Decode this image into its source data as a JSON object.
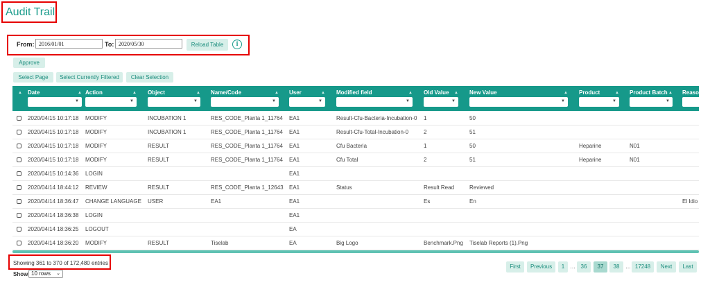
{
  "title": "Audit Trail",
  "filter": {
    "from_label": "From:",
    "from_value": "2016/01/01",
    "to_label": "To:",
    "to_value": "2020/05/30",
    "reload_label": "Reload Table",
    "info_icon": "info-circle-icon"
  },
  "actions": {
    "approve": "Approve",
    "select_page": "Select Page",
    "select_filtered": "Select Currently Filtered",
    "clear_selection": "Clear Selection"
  },
  "columns": [
    "Date",
    "Action",
    "Object",
    "Name/Code",
    "User",
    "Modified field",
    "Old Value",
    "New Value",
    "Product",
    "Product Batch",
    "Reaso"
  ],
  "rows": [
    [
      "2020/04/15 10:17:18",
      "MODIFY",
      "INCUBATION 1",
      "RES_CODE_Planta 1_11764",
      "EA1",
      "Result-Cfu-Bacteria-Incubation-0",
      "1",
      "50",
      "",
      "",
      ""
    ],
    [
      "2020/04/15 10:17:18",
      "MODIFY",
      "INCUBATION 1",
      "RES_CODE_Planta 1_11764",
      "EA1",
      "Result-Cfu-Total-Incubation-0",
      "2",
      "51",
      "",
      "",
      ""
    ],
    [
      "2020/04/15 10:17:18",
      "MODIFY",
      "RESULT",
      "RES_CODE_Planta 1_11764",
      "EA1",
      "Cfu Bacteria",
      "1",
      "50",
      "Heparine",
      "N01",
      ""
    ],
    [
      "2020/04/15 10:17:18",
      "MODIFY",
      "RESULT",
      "RES_CODE_Planta 1_11764",
      "EA1",
      "Cfu Total",
      "2",
      "51",
      "Heparine",
      "N01",
      ""
    ],
    [
      "2020/04/15 10:14:36",
      "LOGIN",
      "",
      "",
      "EA1",
      "",
      "",
      "",
      "",
      "",
      ""
    ],
    [
      "2020/04/14 18:44:12",
      "REVIEW",
      "RESULT",
      "RES_CODE_Planta 1_12643",
      "EA1",
      "Status",
      "Result Read",
      "Reviewed",
      "",
      "",
      ""
    ],
    [
      "2020/04/14 18:36:47",
      "CHANGE LANGUAGE",
      "USER",
      "EA1",
      "EA1",
      "",
      "Es",
      "En",
      "",
      "",
      "El Idio"
    ],
    [
      "2020/04/14 18:36:38",
      "LOGIN",
      "",
      "",
      "EA1",
      "",
      "",
      "",
      "",
      "",
      ""
    ],
    [
      "2020/04/14 18:36:25",
      "LOGOUT",
      "",
      "",
      "EA",
      "",
      "",
      "",
      "",
      "",
      ""
    ],
    [
      "2020/04/14 18:36:20",
      "MODIFY",
      "RESULT",
      "Tiselab",
      "EA",
      "Big Logo",
      "Benchmark.Png",
      "Tiselab Reports (1).Png",
      "",
      "",
      ""
    ]
  ],
  "table_info": "Showing 361 to 370 of 172,480 entries",
  "show": {
    "label": "Show",
    "value": "10 rows"
  },
  "pagination": {
    "first": "First",
    "previous": "Previous",
    "pages": [
      "1",
      "…",
      "36",
      "37",
      "38",
      "…",
      "17248"
    ],
    "current": "37",
    "next": "Next",
    "last": "Last"
  },
  "colors": {
    "accent": "#16998a",
    "highlight": "#e60000",
    "button_bg": "#d7efe9"
  }
}
